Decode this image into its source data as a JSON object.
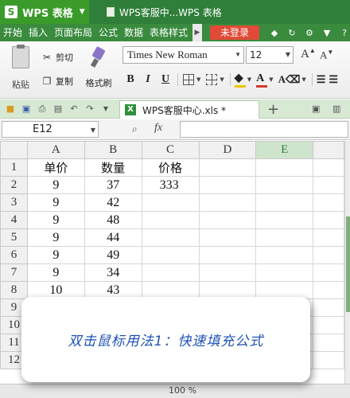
{
  "title_bar": {
    "app_name": "WPS 表格",
    "doc_title": "WPS客服中...WPS 表格"
  },
  "menu": {
    "items": [
      "开始",
      "插入",
      "页面布局",
      "公式",
      "数据",
      "表格样式"
    ],
    "login_label": "未登录"
  },
  "ribbon": {
    "paste_label": "粘贴",
    "cut_label": "剪切",
    "copy_label": "复制",
    "format_painter_label": "格式刷",
    "font_name": "Times New Roman",
    "font_size": "12",
    "grow_label": "A",
    "shrink_label": "A",
    "bold": "B",
    "italic": "I",
    "underline": "U",
    "font_color_letter": "A",
    "font_color": "#d23a2a",
    "fill_color": "#f2c200"
  },
  "tabs": {
    "file_tab": "WPS客服中心.xls *"
  },
  "formula_bar": {
    "cell_ref": "E12",
    "fx_label": "fx"
  },
  "sheet": {
    "selected_column": "E",
    "columns": [
      "A",
      "B",
      "C",
      "D",
      "E"
    ],
    "rows": [
      {
        "num": "1",
        "cells": [
          "单价",
          "数量",
          "价格",
          "",
          ""
        ]
      },
      {
        "num": "2",
        "cells": [
          "9",
          "37",
          "333",
          "",
          ""
        ]
      },
      {
        "num": "3",
        "cells": [
          "9",
          "42",
          "",
          "",
          ""
        ]
      },
      {
        "num": "4",
        "cells": [
          "9",
          "48",
          "",
          "",
          ""
        ]
      },
      {
        "num": "5",
        "cells": [
          "9",
          "44",
          "",
          "",
          ""
        ]
      },
      {
        "num": "6",
        "cells": [
          "9",
          "49",
          "",
          "",
          ""
        ]
      },
      {
        "num": "7",
        "cells": [
          "9",
          "34",
          "",
          "",
          ""
        ]
      },
      {
        "num": "8",
        "cells": [
          "10",
          "43",
          "",
          "",
          ""
        ]
      },
      {
        "num": "9",
        "cells": [
          "",
          "",
          "",
          "",
          ""
        ]
      },
      {
        "num": "10",
        "cells": [
          "",
          "",
          "",
          "",
          ""
        ]
      },
      {
        "num": "11",
        "cells": [
          "",
          "",
          "",
          "",
          ""
        ]
      },
      {
        "num": "12",
        "cells": [
          "",
          "",
          "",
          "",
          ""
        ]
      }
    ]
  },
  "status": {
    "zoom": "100 %"
  },
  "annotation": {
    "text": "双击鼠标用法1：快速填充公式"
  }
}
